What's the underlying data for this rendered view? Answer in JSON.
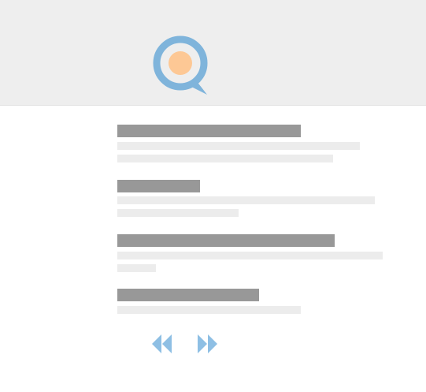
{
  "header": {
    "logo_icon": "search-magnifier-logo-icon"
  },
  "colors": {
    "header_bg": "#eeeeee",
    "title_placeholder": "#989898",
    "line_placeholder": "#ececec",
    "accent_blue": "#8ebfe4",
    "logo_ring": "#7fb4db",
    "logo_dot": "#fdc895"
  },
  "results": [
    {
      "title": "",
      "snippet_lines": [
        "",
        ""
      ]
    },
    {
      "title": "",
      "snippet_lines": [
        "",
        ""
      ]
    },
    {
      "title": "",
      "snippet_lines": [
        "",
        ""
      ]
    },
    {
      "title": "",
      "snippet_lines": [
        ""
      ]
    }
  ],
  "pagination": {
    "prev_icon": "double-chevron-left-icon",
    "next_icon": "double-chevron-right-icon"
  }
}
